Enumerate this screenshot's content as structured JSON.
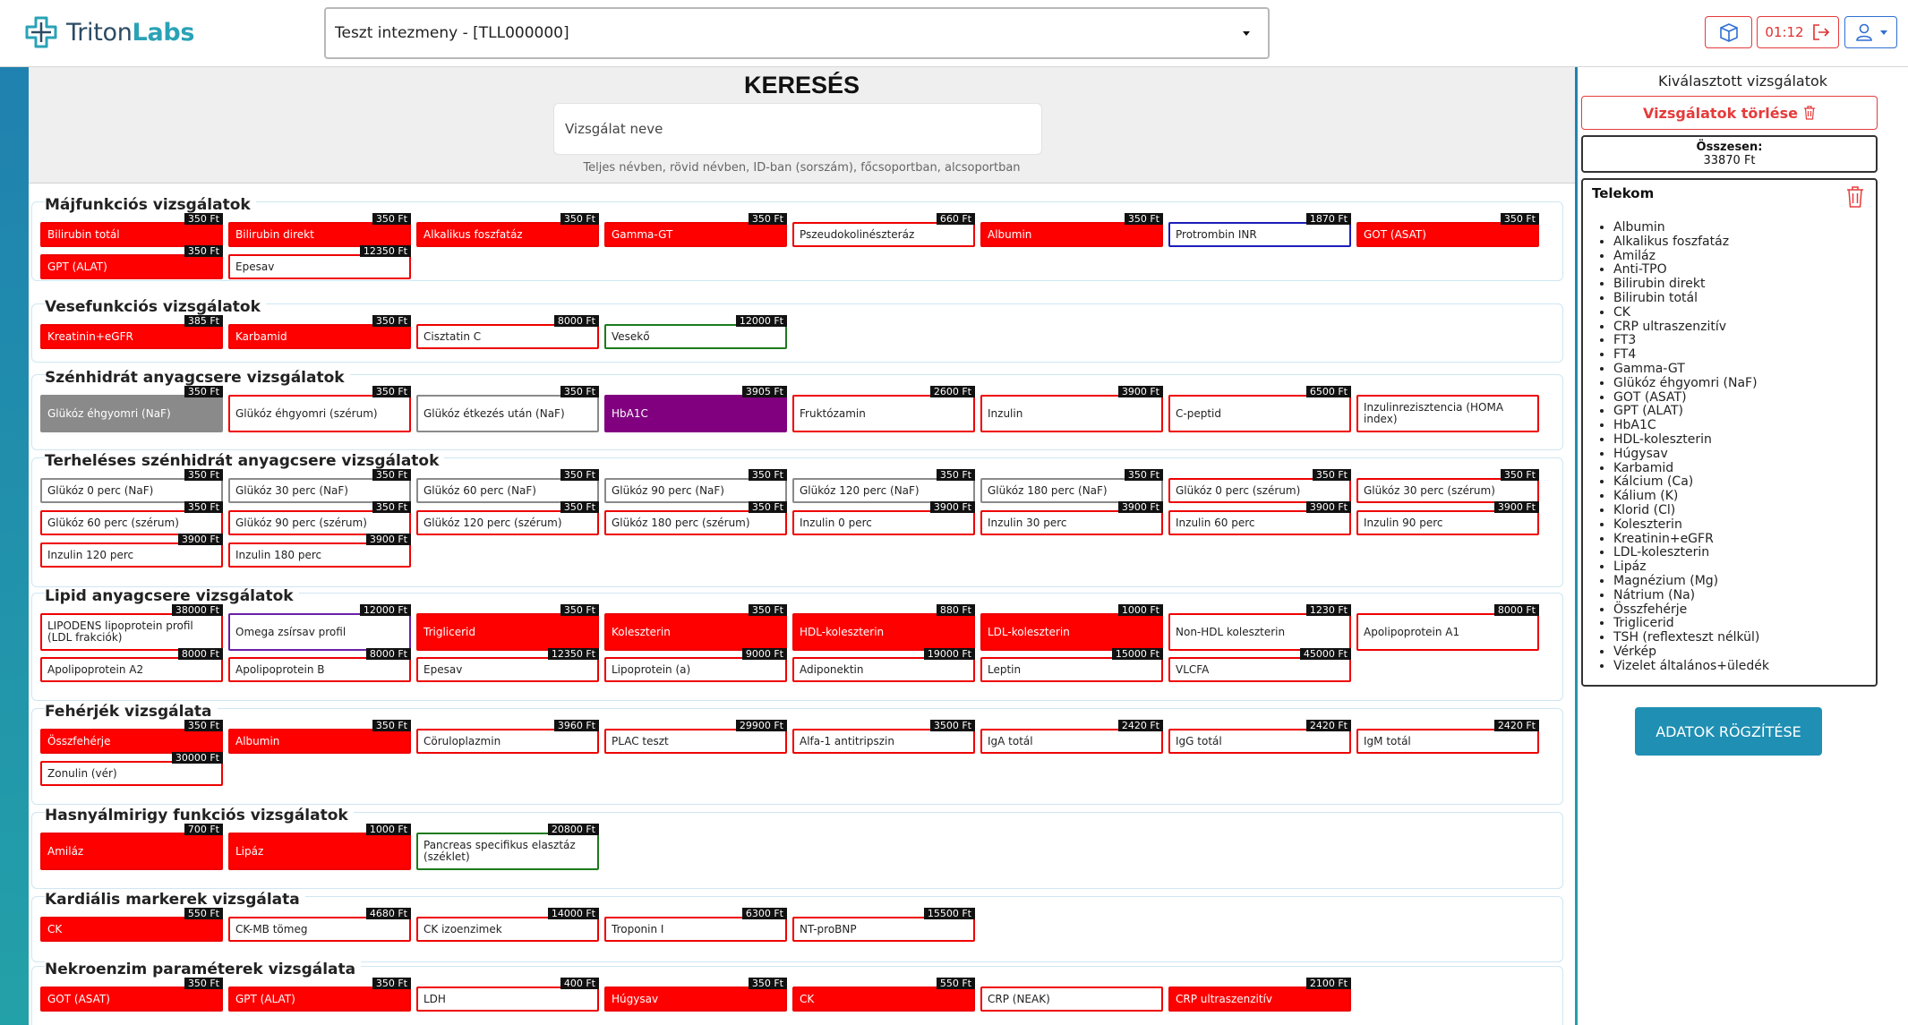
{
  "header": {
    "logo_part1": "Triton",
    "logo_part2": "Labs",
    "institution": "Teszt intezmeny - [TLL000000]",
    "timer": "01:12"
  },
  "search": {
    "title": "KERESÉS",
    "placeholder": "Vizsgálat neve",
    "hint": "Teljes névben, rövid névben, ID-ban (sorszám), főcsoportban, alcsoportban"
  },
  "sections": [
    {
      "title": "Májfunkciós vizsgálatok",
      "tests": [
        {
          "name": "Bilirubin totál",
          "price": "350 Ft",
          "state": "red"
        },
        {
          "name": "Bilirubin direkt",
          "price": "350 Ft",
          "state": "red"
        },
        {
          "name": "Alkalikus foszfatáz",
          "price": "350 Ft",
          "state": "red"
        },
        {
          "name": "Gamma-GT",
          "price": "350 Ft",
          "state": "red"
        },
        {
          "name": "Pszeudokolinészteráz",
          "price": "660 Ft",
          "state": "outline"
        },
        {
          "name": "Albumin",
          "price": "350 Ft",
          "state": "red"
        },
        {
          "name": "Protrombin INR",
          "price": "1870 Ft",
          "state": "blue"
        },
        {
          "name": "GOT (ASAT)",
          "price": "350 Ft",
          "state": "red"
        },
        {
          "name": "GPT (ALAT)",
          "price": "350 Ft",
          "state": "red"
        },
        {
          "name": "Epesav",
          "price": "12350 Ft",
          "state": "outline"
        }
      ]
    },
    {
      "title": "Vesefunkciós vizsgálatok",
      "tests": [
        {
          "name": "Kreatinin+eGFR",
          "price": "385 Ft",
          "state": "red"
        },
        {
          "name": "Karbamid",
          "price": "350 Ft",
          "state": "red"
        },
        {
          "name": "Cisztatin C",
          "price": "8000 Ft",
          "state": "outline"
        },
        {
          "name": "Vesekő",
          "price": "12000 Ft",
          "state": "green"
        }
      ]
    },
    {
      "title": "Szénhidrát anyagcsere vizsgálatok",
      "tests": [
        {
          "name": "Glükóz éhgyomri (NaF)",
          "price": "350 Ft",
          "state": "gray"
        },
        {
          "name": "Glükóz éhgyomri (szérum)",
          "price": "350 Ft",
          "state": "outline"
        },
        {
          "name": "Glükóz étkezés után (NaF)",
          "price": "350 Ft",
          "state": "graybd"
        },
        {
          "name": "HbA1C",
          "price": "3905 Ft",
          "state": "purple"
        },
        {
          "name": "Fruktózamin",
          "price": "2600 Ft",
          "state": "outline"
        },
        {
          "name": "Inzulin",
          "price": "3900 Ft",
          "state": "outline"
        },
        {
          "name": "C-peptid",
          "price": "6500 Ft",
          "state": "outline"
        },
        {
          "name": "Inzulinrezisztencia (HOMA index)",
          "price": "",
          "state": "outline"
        }
      ]
    },
    {
      "title": "Terheléses szénhidrát anyagcsere vizsgálatok",
      "tests": [
        {
          "name": "Glükóz 0 perc (NaF)",
          "price": "350 Ft",
          "state": "graybd"
        },
        {
          "name": "Glükóz 30 perc (NaF)",
          "price": "350 Ft",
          "state": "graybd"
        },
        {
          "name": "Glükóz 60 perc (NaF)",
          "price": "350 Ft",
          "state": "graybd"
        },
        {
          "name": "Glükóz 90 perc (NaF)",
          "price": "350 Ft",
          "state": "graybd"
        },
        {
          "name": "Glükóz 120 perc (NaF)",
          "price": "350 Ft",
          "state": "graybd"
        },
        {
          "name": "Glükóz 180 perc (NaF)",
          "price": "350 Ft",
          "state": "graybd"
        },
        {
          "name": "Glükóz 0 perc (szérum)",
          "price": "350 Ft",
          "state": "outline"
        },
        {
          "name": "Glükóz 30 perc (szérum)",
          "price": "350 Ft",
          "state": "outline"
        },
        {
          "name": "Glükóz 60 perc (szérum)",
          "price": "350 Ft",
          "state": "outline"
        },
        {
          "name": "Glükóz 90 perc (szérum)",
          "price": "350 Ft",
          "state": "outline"
        },
        {
          "name": "Glükóz 120 perc (szérum)",
          "price": "350 Ft",
          "state": "outline"
        },
        {
          "name": "Glükóz 180 perc (szérum)",
          "price": "350 Ft",
          "state": "outline"
        },
        {
          "name": "Inzulin 0 perc",
          "price": "3900 Ft",
          "state": "outline"
        },
        {
          "name": "Inzulin 30 perc",
          "price": "3900 Ft",
          "state": "outline"
        },
        {
          "name": "Inzulin 60 perc",
          "price": "3900 Ft",
          "state": "outline"
        },
        {
          "name": "Inzulin 90 perc",
          "price": "3900 Ft",
          "state": "outline"
        },
        {
          "name": "Inzulin 120 perc",
          "price": "3900 Ft",
          "state": "outline"
        },
        {
          "name": "Inzulin 180 perc",
          "price": "3900 Ft",
          "state": "outline"
        }
      ]
    },
    {
      "title": "Lipid anyagcsere vizsgálatok",
      "tests": [
        {
          "name": "LIPODENS lipoprotein profil (LDL frakciók)",
          "price": "38000 Ft",
          "state": "outline"
        },
        {
          "name": "Omega zsírsav profil",
          "price": "12000 Ft",
          "state": "violet"
        },
        {
          "name": "Triglicerid",
          "price": "350 Ft",
          "state": "red"
        },
        {
          "name": "Koleszterin",
          "price": "350 Ft",
          "state": "red"
        },
        {
          "name": "HDL-koleszterin",
          "price": "880 Ft",
          "state": "red"
        },
        {
          "name": "LDL-koleszterin",
          "price": "1000 Ft",
          "state": "red"
        },
        {
          "name": "Non-HDL koleszterin",
          "price": "1230 Ft",
          "state": "outline"
        },
        {
          "name": "Apolipoprotein A1",
          "price": "8000 Ft",
          "state": "outline"
        },
        {
          "name": "Apolipoprotein A2",
          "price": "8000 Ft",
          "state": "outline"
        },
        {
          "name": "Apolipoprotein B",
          "price": "8000 Ft",
          "state": "outline"
        },
        {
          "name": "Epesav",
          "price": "12350 Ft",
          "state": "outline"
        },
        {
          "name": "Lipoprotein (a)",
          "price": "9000 Ft",
          "state": "outline"
        },
        {
          "name": "Adiponektin",
          "price": "19000 Ft",
          "state": "outline"
        },
        {
          "name": "Leptin",
          "price": "15000 Ft",
          "state": "outline"
        },
        {
          "name": "VLCFA",
          "price": "45000 Ft",
          "state": "outline"
        }
      ]
    },
    {
      "title": "Fehérjék vizsgálata",
      "tests": [
        {
          "name": "Összfehérje",
          "price": "350 Ft",
          "state": "red"
        },
        {
          "name": "Albumin",
          "price": "350 Ft",
          "state": "red"
        },
        {
          "name": "Cöruloplazmin",
          "price": "3960 Ft",
          "state": "outline"
        },
        {
          "name": "PLAC teszt",
          "price": "29900 Ft",
          "state": "outline"
        },
        {
          "name": "Alfa-1 antitripszin",
          "price": "3500 Ft",
          "state": "outline"
        },
        {
          "name": "IgA totál",
          "price": "2420 Ft",
          "state": "outline"
        },
        {
          "name": "IgG totál",
          "price": "2420 Ft",
          "state": "outline"
        },
        {
          "name": "IgM totál",
          "price": "2420 Ft",
          "state": "outline"
        },
        {
          "name": "Zonulin (vér)",
          "price": "30000 Ft",
          "state": "outline"
        }
      ]
    },
    {
      "title": "Hasnyálmirigy funkciós vizsgálatok",
      "tests": [
        {
          "name": "Amiláz",
          "price": "700 Ft",
          "state": "red"
        },
        {
          "name": "Lipáz",
          "price": "1000 Ft",
          "state": "red"
        },
        {
          "name": "Pancreas specifikus elasztáz (széklet)",
          "price": "20800 Ft",
          "state": "green"
        }
      ]
    },
    {
      "title": "Kardiális markerek vizsgálata",
      "tests": [
        {
          "name": "CK",
          "price": "550 Ft",
          "state": "red"
        },
        {
          "name": "CK-MB tömeg",
          "price": "4680 Ft",
          "state": "outline"
        },
        {
          "name": "CK izoenzimek",
          "price": "14000 Ft",
          "state": "outline"
        },
        {
          "name": "Troponin I",
          "price": "6300 Ft",
          "state": "outline"
        },
        {
          "name": "NT-proBNP",
          "price": "15500 Ft",
          "state": "outline"
        }
      ]
    },
    {
      "title": "Nekroenzim paraméterek vizsgálata",
      "tests": [
        {
          "name": "GOT (ASAT)",
          "price": "350 Ft",
          "state": "red"
        },
        {
          "name": "GPT (ALAT)",
          "price": "350 Ft",
          "state": "red"
        },
        {
          "name": "LDH",
          "price": "400 Ft",
          "state": "outline"
        },
        {
          "name": "Húgysav",
          "price": "350 Ft",
          "state": "red"
        },
        {
          "name": "CK",
          "price": "550 Ft",
          "state": "red"
        },
        {
          "name": "CRP (NEAK)",
          "price": "",
          "state": "outline"
        },
        {
          "name": "CRP ultraszenzitív",
          "price": "2100 Ft",
          "state": "red"
        }
      ]
    }
  ],
  "side": {
    "title": "Kiválasztott vizsgálatok",
    "clear_label": "Vizsgálatok törlése",
    "total_label": "Összesen:",
    "total_value": "33870 Ft",
    "group_title": "Telekom",
    "items": [
      "Albumin",
      "Alkalikus foszfatáz",
      "Amiláz",
      "Anti-TPO",
      "Bilirubin direkt",
      "Bilirubin totál",
      "CK",
      "CRP ultraszenzitív",
      "FT3",
      "FT4",
      "Gamma-GT",
      "Glükóz éhgyomri (NaF)",
      "GOT (ASAT)",
      "GPT (ALAT)",
      "HbA1C",
      "HDL-koleszterin",
      "Húgysav",
      "Karbamid",
      "Kálcium (Ca)",
      "Kálium (K)",
      "Klorid (Cl)",
      "Koleszterin",
      "Kreatinin+eGFR",
      "LDL-koleszterin",
      "Lipáz",
      "Magnézium (Mg)",
      "Nátrium (Na)",
      "Összfehérje",
      "Triglicerid",
      "TSH (reflexteszt nélkül)",
      "Vérkép",
      "Vizelet általános+üledék"
    ],
    "save_label": "ADATOK RÖGZÍTÉSE"
  }
}
